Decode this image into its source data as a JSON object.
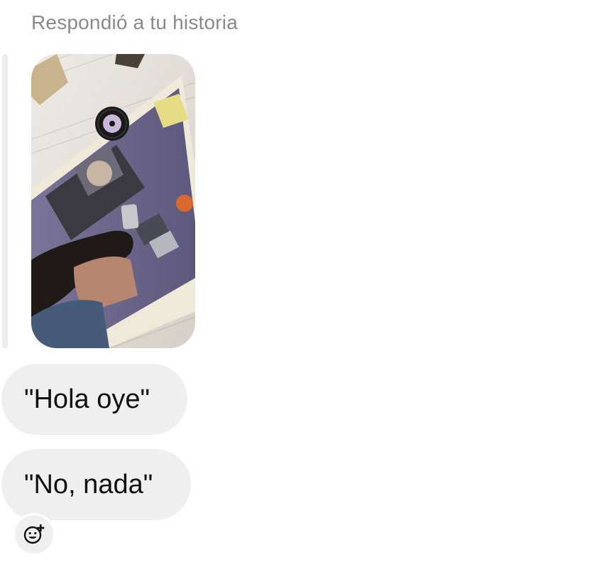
{
  "reply_caption": "Respondió a tu historia",
  "story": {
    "has_music_sticker": true
  },
  "messages": [
    {
      "text": "\"Hola oye\""
    },
    {
      "text": "\"No, nada\""
    }
  ],
  "reaction_button": {
    "icon": "add-reaction-icon"
  },
  "colors": {
    "bubble_background": "#efefef",
    "caption_text": "#8a8a8a",
    "message_text": "#111111"
  }
}
